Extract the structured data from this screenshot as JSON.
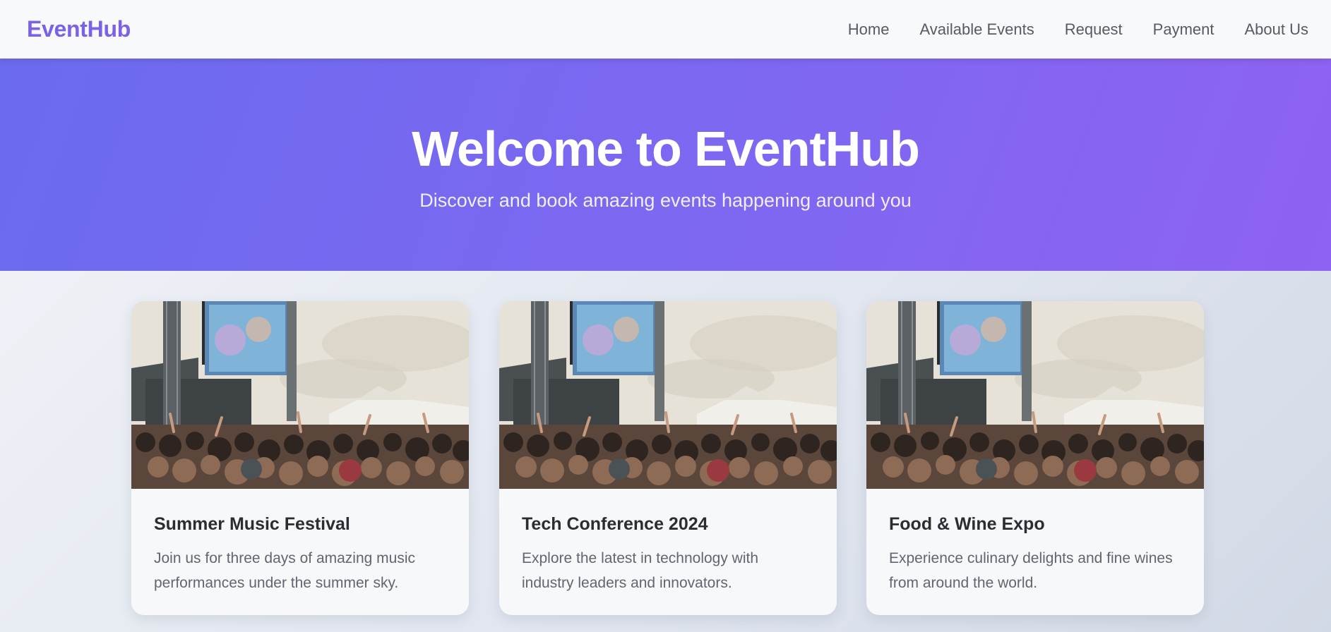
{
  "brand": "EventHub",
  "nav": {
    "items": [
      {
        "label": "Home"
      },
      {
        "label": "Available Events"
      },
      {
        "label": "Request"
      },
      {
        "label": "Payment"
      },
      {
        "label": "About Us"
      }
    ]
  },
  "hero": {
    "title": "Welcome to EventHub",
    "subtitle": "Discover and book amazing events happening around you"
  },
  "events": [
    {
      "title": "Summer Music Festival",
      "description": "Join us for three days of amazing music performances under the summer sky."
    },
    {
      "title": "Tech Conference 2024",
      "description": "Explore the latest in technology with industry leaders and innovators."
    },
    {
      "title": "Food & Wine Expo",
      "description": "Experience culinary delights and fine wines from around the world."
    }
  ],
  "colors": {
    "brand": "#7b61e6",
    "hero_start": "#6b6bef",
    "hero_end": "#8e62f2"
  }
}
